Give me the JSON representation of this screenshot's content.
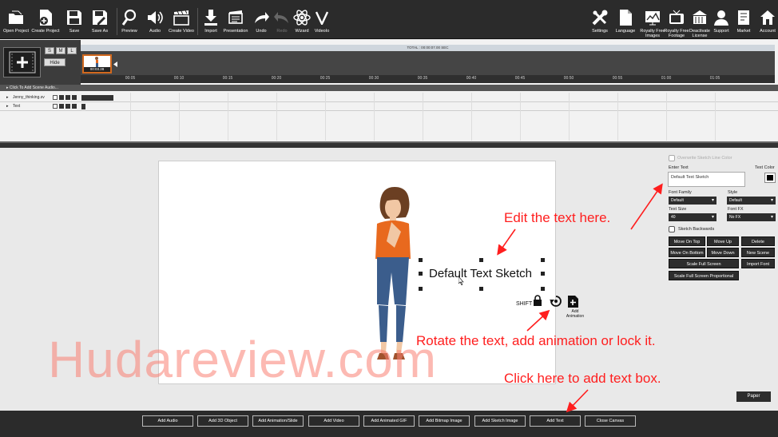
{
  "toolbar": {
    "left_tools": [
      {
        "label": "Open Project",
        "icon": "open-folder-icon"
      },
      {
        "label": "Create Project",
        "icon": "new-file-icon"
      },
      {
        "label": "Save",
        "icon": "floppy-icon"
      },
      {
        "label": "Save As",
        "icon": "floppy-edit-icon"
      },
      {
        "label": "Preview",
        "icon": "magnifier-icon"
      },
      {
        "label": "Audio",
        "icon": "speaker-icon"
      },
      {
        "label": "Create Video",
        "icon": "clapper-icon"
      },
      {
        "label": "Import",
        "icon": "download-icon"
      },
      {
        "label": "Presentation",
        "icon": "presentation-icon"
      },
      {
        "label": "Undo",
        "icon": "undo-icon"
      },
      {
        "label": "Redo",
        "icon": "redo-icon"
      },
      {
        "label": "Wizard",
        "icon": "atom-icon"
      },
      {
        "label": "VideoIo",
        "icon": "v-logo-icon"
      }
    ],
    "right_tools": [
      {
        "label": "Settings",
        "icon": "tools-icon"
      },
      {
        "label": "Language",
        "icon": "document-icon"
      },
      {
        "label": "Royalty Free Images",
        "icon": "image-chart-icon"
      },
      {
        "label": "Royalty Free Footage",
        "icon": "tv-icon"
      },
      {
        "label": "Deactivate License",
        "icon": "building-icon"
      },
      {
        "label": "Support",
        "icon": "support-person-icon"
      },
      {
        "label": "Market",
        "icon": "market-icon"
      },
      {
        "label": "Account",
        "icon": "home-icon"
      }
    ]
  },
  "timeline": {
    "size_buttons": [
      "S",
      "M",
      "L"
    ],
    "hide_label": "Hide",
    "total_label": "TOTAL : 00:00:07.00 SEC",
    "scene_time": "00:03.28",
    "ruler_ticks": [
      "00:05",
      "00:10",
      "00:15",
      "00:20",
      "00:25",
      "00:30",
      "00:35",
      "00:40",
      "00:45",
      "00:50",
      "00:55",
      "01:00",
      "01:05"
    ],
    "track_header": "Click To Add Scene Audio...",
    "tracks": [
      {
        "name": "Jenny_thinking.sv"
      },
      {
        "name": "Text"
      }
    ]
  },
  "canvas": {
    "text_content": "Default Text Sketch",
    "shift_label": "SHIFT",
    "add_animation_label": "Add Animation",
    "lock_icon": "lock-icon",
    "rotate_icon": "rotate-icon"
  },
  "right_panel": {
    "overwrite_label": "Overwrite Sketch Line Color",
    "enter_text_label": "Enter Text",
    "text_value": "Default Text Sketch",
    "text_color_label": "Text Color",
    "text_color": "#000000",
    "font_family_label": "Font Family",
    "font_family_value": "Default",
    "style_label": "Style",
    "style_value": "Default",
    "text_size_label": "Text Size",
    "text_size_value": "40",
    "font_fx_label": "Font FX",
    "font_fx_value": "No FX",
    "sketch_backwards_label": "Sketch Backwards",
    "buttons": {
      "move_on_top": "Move On Top",
      "move_up": "Move Up",
      "delete": "Delete",
      "move_on_bottom": "Move On Bottom",
      "move_down": "Move Down",
      "new_scene": "New Scene",
      "scale_full_screen": "Scale Full Screen",
      "import_font": "Import Font",
      "scale_full_screen_proportional": "Scale Full Screen Proportional"
    },
    "paper_label": "Paper"
  },
  "bottom_bar": {
    "buttons": [
      "Add Audio",
      "Add 3D Object",
      "Add Animation/Slide",
      "Add Video",
      "Add Animated GIF",
      "Add Bitmap Image",
      "Add Sketch Image",
      "Add Text",
      "Close Canvas"
    ]
  },
  "annotations": {
    "edit_text": "Edit the text here.",
    "rotate_text": "Rotate the text, add animation or lock it.",
    "add_text_box": "Click here to add text box.",
    "watermark": "Hudareview.com",
    "color": "#ff1e1e"
  }
}
